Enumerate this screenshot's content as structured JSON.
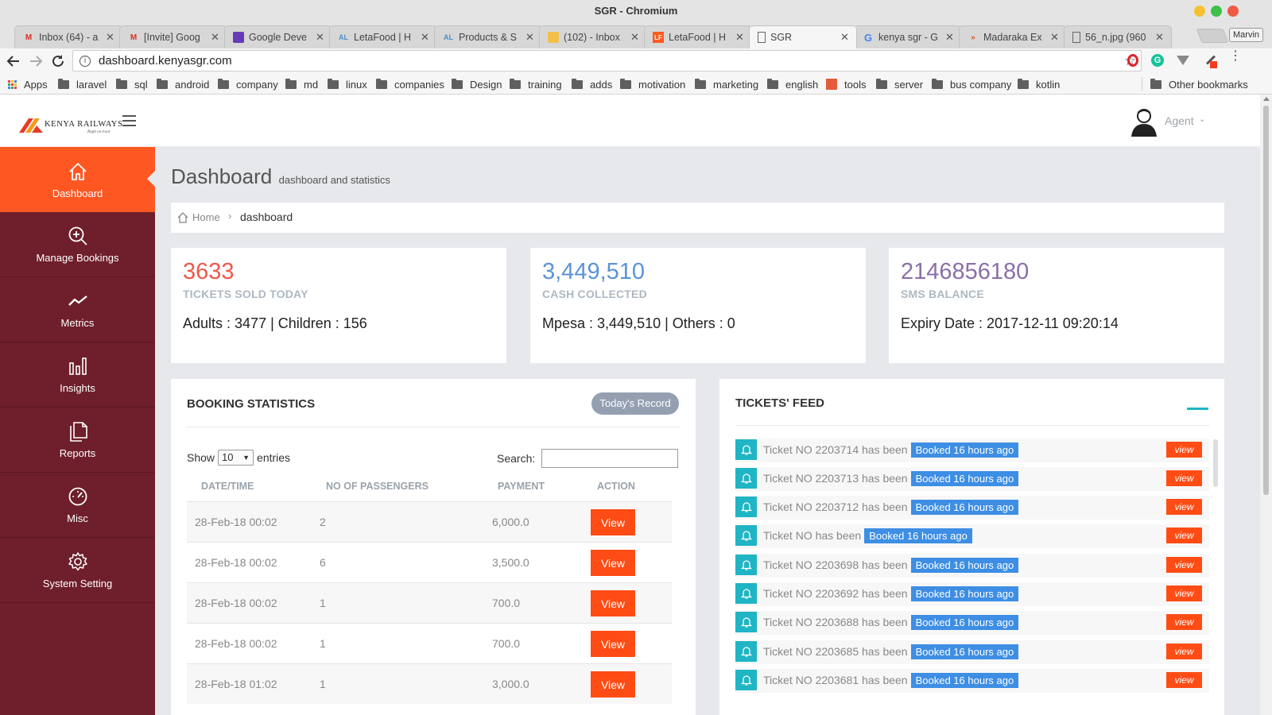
{
  "browser": {
    "title": "SGR - Chromium",
    "tabs": [
      {
        "label": "Inbox (64) - a",
        "icon": "gmail-icon"
      },
      {
        "label": "[Invite] Goog",
        "icon": "gmail-icon"
      },
      {
        "label": "Google Deve",
        "icon": "forms-icon"
      },
      {
        "label": "LetaFood | H",
        "icon": "site-icon"
      },
      {
        "label": "Products & S",
        "icon": "site-icon"
      },
      {
        "label": "(102) - Inbox",
        "icon": "mail-icon"
      },
      {
        "label": "LetaFood | H",
        "icon": "letafood-icon"
      },
      {
        "label": "SGR",
        "icon": "page-icon"
      },
      {
        "label": "kenya sgr - G",
        "icon": "google-icon"
      },
      {
        "label": "Madaraka Ex",
        "icon": "madaraka-icon"
      },
      {
        "label": "56_n.jpg (960",
        "icon": "page-icon"
      }
    ],
    "profile": "Marvin",
    "url": "dashboard.kenyasgr.com",
    "bookmarks": [
      "Apps",
      "laravel",
      "sql",
      "android",
      "company",
      "md",
      "linux",
      "companies",
      "Design",
      "training",
      "adds",
      "motivation",
      "marketing",
      "english",
      "tools",
      "server",
      "bus company",
      "kotlin"
    ],
    "other_bookmarks": "Other bookmarks"
  },
  "header": {
    "logo_text": "KENYA RAILWAYS",
    "logo_tagline": "Right on track",
    "user": "Agent"
  },
  "sidebar": [
    {
      "label": "Dashboard",
      "icon": "home-icon",
      "active": true
    },
    {
      "label": "Manage Bookings",
      "icon": "zoom-in-icon"
    },
    {
      "label": "Metrics",
      "icon": "trend-line-icon"
    },
    {
      "label": "Insights",
      "icon": "bar-chart-icon"
    },
    {
      "label": "Reports",
      "icon": "documents-icon"
    },
    {
      "label": "Misc",
      "icon": "speedometer-icon"
    },
    {
      "label": "System Setting",
      "icon": "gear-icon"
    }
  ],
  "page": {
    "title": "Dashboard",
    "subtitle": "dashboard and statistics",
    "breadcrumb_home": "Home",
    "breadcrumb_current": "dashboard"
  },
  "stats": [
    {
      "value": "3633",
      "label": "TICKETS SOLD TODAY",
      "detail": "Adults : 3477 | Children : 156",
      "color": "#f0574b"
    },
    {
      "value": "3,449,510",
      "label": "CASH COLLECTED",
      "detail": "Mpesa : 3,449,510 | Others : 0",
      "color": "#5a93d8"
    },
    {
      "value": "2146856180",
      "label": "SMS BALANCE",
      "detail": "Expiry Date : 2017-12-11 09:20:14",
      "color": "#8a6fa8"
    }
  ],
  "booking": {
    "title": "BOOKING STATISTICS",
    "record_button": "Today's Record",
    "show_label": "Show",
    "entries_value": "10",
    "entries_label": "entries",
    "search_label": "Search:",
    "columns": [
      "DATE/TIME",
      "NO OF PASSENGERS",
      "PAYMENT",
      "ACTION"
    ],
    "rows": [
      {
        "date": "28-Feb-18 00:02",
        "passengers": "2",
        "payment": "6,000.0",
        "action": "View"
      },
      {
        "date": "28-Feb-18 00:02",
        "passengers": "6",
        "payment": "3,500.0",
        "action": "View"
      },
      {
        "date": "28-Feb-18 00:02",
        "passengers": "1",
        "payment": "700.0",
        "action": "View"
      },
      {
        "date": "28-Feb-18 00:02",
        "passengers": "1",
        "payment": "700.0",
        "action": "View"
      },
      {
        "date": "28-Feb-18 01:02",
        "passengers": "1",
        "payment": "3,000.0",
        "action": "View"
      }
    ]
  },
  "feed": {
    "title": "TICKETS' FEED",
    "items": [
      {
        "text": "Ticket NO 2203714 has been",
        "badge": "Booked 16 hours ago",
        "action": "view"
      },
      {
        "text": "Ticket NO 2203713 has been",
        "badge": "Booked 16 hours ago",
        "action": "view"
      },
      {
        "text": "Ticket NO 2203712 has been",
        "badge": "Booked 16 hours ago",
        "action": "view"
      },
      {
        "text": "Ticket NO has been",
        "badge": "Booked 16 hours ago",
        "action": "view"
      },
      {
        "text": "Ticket NO 2203698 has been",
        "badge": "Booked 16 hours ago",
        "action": "view"
      },
      {
        "text": "Ticket NO 2203692 has been",
        "badge": "Booked 16 hours ago",
        "action": "view"
      },
      {
        "text": "Ticket NO 2203688 has been",
        "badge": "Booked 16 hours ago",
        "action": "view"
      },
      {
        "text": "Ticket NO 2203685 has been",
        "badge": "Booked 16 hours ago",
        "action": "view"
      },
      {
        "text": "Ticket NO 2203681 has been",
        "badge": "Booked 16 hours ago",
        "action": "view"
      }
    ]
  },
  "colors": {
    "accent": "#ff5722",
    "sidebar": "#6e1f2b",
    "badge": "#3d8ee4",
    "bell": "#1fb5c4"
  }
}
